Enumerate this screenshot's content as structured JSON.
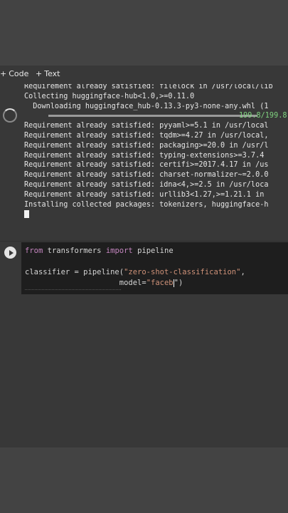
{
  "toolbar": {
    "add_code_label": "Code",
    "add_text_label": "Text"
  },
  "output": {
    "lines": [
      "Requirement already satisfied: filelock in /usr/local/lib",
      "Collecting huggingface-hub<1.0,>=0.11.0",
      "  Downloading huggingface_hub-0.13.3-py3-none-any.whl (1",
      "Requirement already satisfied: pyyaml>=5.1 in /usr/local",
      "Requirement already satisfied: tqdm>=4.27 in /usr/local,",
      "Requirement already satisfied: packaging>=20.0 in /usr/l",
      "Requirement already satisfied: typing-extensions>=3.7.4",
      "Requirement already satisfied: certifi>=2017.4.17 in /us",
      "Requirement already satisfied: charset-normalizer~=2.0.0",
      "Requirement already satisfied: idna<4,>=2.5 in /usr/loca",
      "Requirement already satisfied: urllib3<1.27,>=1.21.1 in",
      "Installing collected packages: tokenizers, huggingface-h"
    ],
    "download_progress_text": "199.8/199.8"
  },
  "code": {
    "line1_kw1": "from",
    "line1_mid": " transformers ",
    "line1_kw2": "import",
    "line1_end": " pipeline",
    "line3_start": "classifier = pipeline(",
    "line3_str": "\"zero-shot-classification\"",
    "line3_end": ",",
    "line4_start": "                     model=",
    "line4_str": "\"faceb",
    "line4_end": "\")"
  },
  "colors": {
    "progress_text": "#7fd37f",
    "keyword": "#c586c0",
    "string": "#ce9178"
  }
}
